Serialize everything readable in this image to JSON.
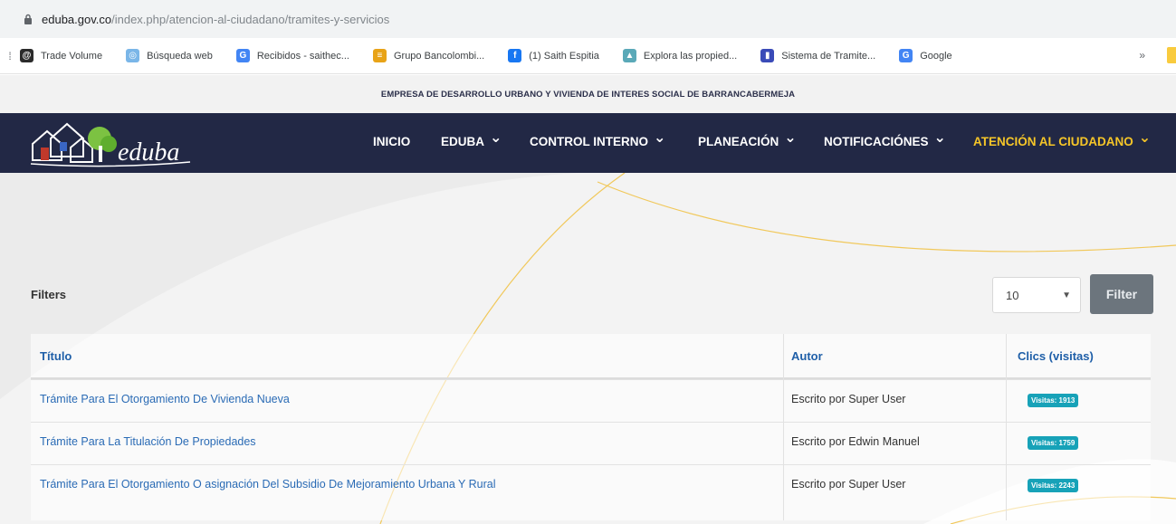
{
  "browser": {
    "url_domain": "eduba.gov.co",
    "url_path": "/index.php/atencion-al-ciudadano/tramites-y-servicios",
    "bookmarks": [
      {
        "label": "Trade Volume",
        "icon": "trade-volume-icon",
        "color": "#2b2b2b",
        "glyph": "@"
      },
      {
        "label": "Búsqueda web",
        "icon": "web-search-icon",
        "color": "#7ab6e8",
        "glyph": "◎"
      },
      {
        "label": "Recibidos - saithec...",
        "icon": "google-icon",
        "color": "#4285f4",
        "glyph": "G"
      },
      {
        "label": "Grupo Bancolombi...",
        "icon": "bancolombia-icon",
        "color": "#e8a317",
        "glyph": "≡"
      },
      {
        "label": "(1) Saith Espitia",
        "icon": "facebook-icon",
        "color": "#1877f2",
        "glyph": "f"
      },
      {
        "label": "Explora las propied...",
        "icon": "property-icon",
        "color": "#5aa9b8",
        "glyph": "▲"
      },
      {
        "label": "Sistema de Tramite...",
        "icon": "system-icon",
        "color": "#3a4bb8",
        "glyph": "▮"
      },
      {
        "label": "Google",
        "icon": "google-icon",
        "color": "#4285f4",
        "glyph": "G"
      }
    ],
    "more": "»"
  },
  "header": {
    "org_name": "EMPRESA DE DESARROLLO URBANO Y VIVIENDA DE INTERES SOCIAL DE BARRANCABERMEJA",
    "logo_text": "eduba"
  },
  "nav": {
    "items": [
      {
        "label": "INICIO",
        "dropdown": false
      },
      {
        "label": "EDUBA",
        "dropdown": true
      },
      {
        "label": "CONTROL INTERNO",
        "dropdown": true
      },
      {
        "label": "PLANEACIÓN",
        "dropdown": true
      },
      {
        "label": "NOTIFICACIÓNES",
        "dropdown": true
      },
      {
        "label": "ATENCIÓN AL CIUDADANO",
        "dropdown": true,
        "active": true
      }
    ],
    "caret": "⌄",
    "active_color": "#f6c628"
  },
  "filters": {
    "label": "Filters",
    "limit_value": "10",
    "button_label": "Filter"
  },
  "table": {
    "headers": {
      "title": "Título",
      "author": "Autor",
      "clicks": "Clics (visitas)"
    },
    "rows": [
      {
        "title": "Trámite Para El Otorgamiento De Vivienda Nueva",
        "author": "Escrito por Super User",
        "visits": "Visitas: 1913"
      },
      {
        "title": "Trámite Para La Titulación De Propiedades",
        "author": "Escrito por Edwin Manuel",
        "visits": "Visitas: 1759"
      },
      {
        "title": "Trámite Para El Otorgamiento O asignación Del Subsidio De Mejoramiento Urbana Y Rural",
        "author": "Escrito por Super User",
        "visits": "Visitas: 2243"
      }
    ]
  },
  "colors": {
    "navbar": "#222845",
    "link": "#2a6bb5",
    "badge": "#17a2b8",
    "accent": "#f6c628"
  }
}
